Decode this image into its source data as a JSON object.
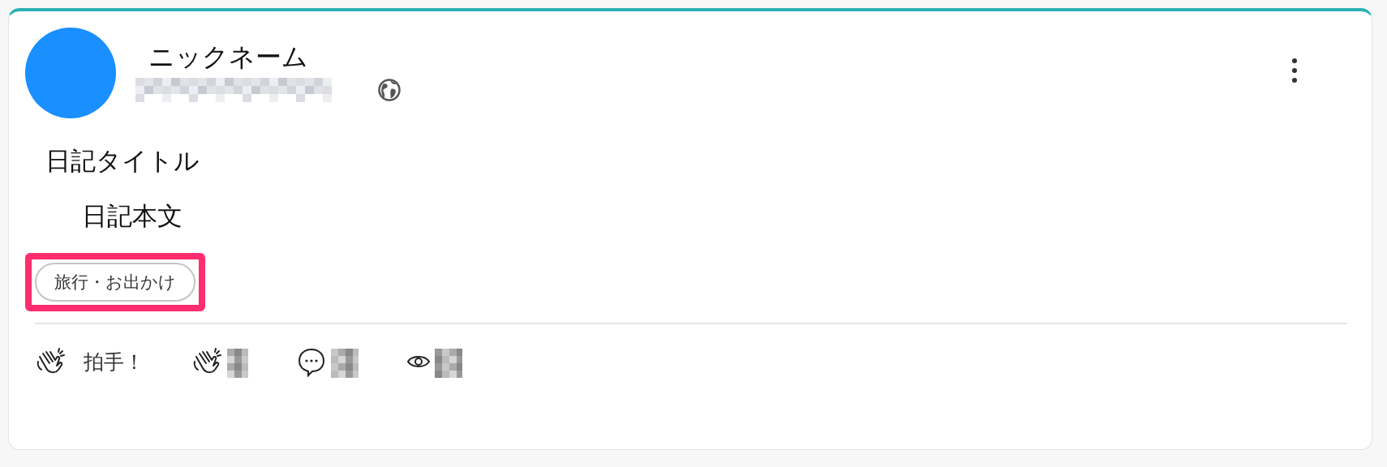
{
  "post": {
    "author": {
      "nickname": "ニックネーム"
    },
    "title": "日記タイトル",
    "body": "日記本文",
    "tags": [
      {
        "label": "旅行・お出かけ"
      }
    ],
    "tags_highlighted": true,
    "clap_button": {
      "label": "拍手！"
    }
  }
}
